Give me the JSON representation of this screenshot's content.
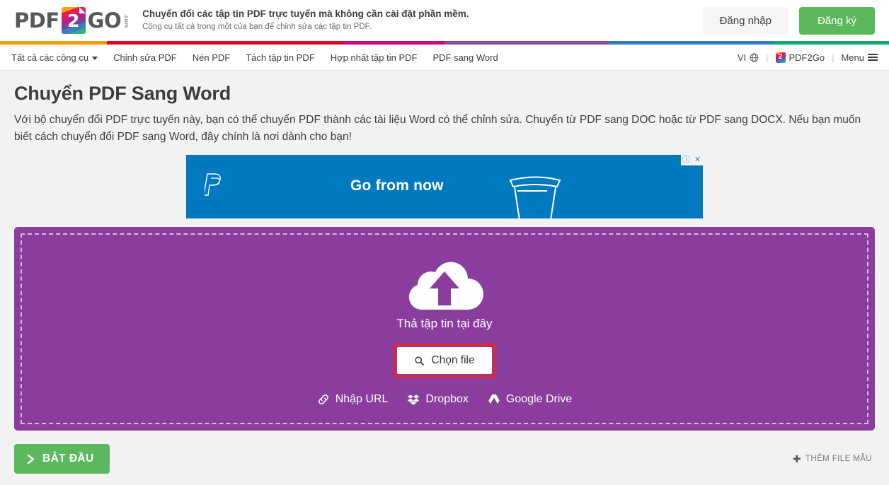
{
  "header": {
    "logo": {
      "part1": "PDF",
      "badge": "2",
      "part2": "GO",
      "suffix": ".com"
    },
    "tagline_main": "Chuyển đổi các tập tin PDF trực tuyến mà không cần cài đặt phần mềm.",
    "tagline_sub": "Công cụ tất cả trong một của bạn để chỉnh sửa các tập tin PDF.",
    "login_label": "Đăng nhập",
    "signup_label": "Đăng ký",
    "signup_color": "#5cb85c"
  },
  "stripe": {
    "colors": [
      "#ef9b0f",
      "#e3051f",
      "#c9077f",
      "#8b4a9e",
      "#2f7fb8",
      "#12a875"
    ],
    "widths": [
      "12%",
      "26.5%",
      "11.5%",
      "18.5%",
      "18.5%",
      "13%"
    ]
  },
  "nav": {
    "items": [
      {
        "label": "Tất cả các công cụ",
        "has_caret": true
      },
      {
        "label": "Chỉnh sửa PDF",
        "has_caret": false
      },
      {
        "label": "Nén PDF",
        "has_caret": false
      },
      {
        "label": "Tách tập tin PDF",
        "has_caret": false
      },
      {
        "label": "Hợp nhất tập tin PDF",
        "has_caret": false
      },
      {
        "label": "PDF sang Word",
        "has_caret": false
      }
    ],
    "language": "VI",
    "language_icon": "globe-icon",
    "account": "PDF2Go",
    "account_badge": "2",
    "menu": "Menu",
    "menu_icon": "hamburger-icon",
    "separator": "|"
  },
  "main": {
    "title": "Chuyển PDF Sang Word",
    "description": "Với bộ chuyển đổi PDF trực tuyến này, bạn có thể chuyển PDF thành các tài liệu Word có thể chỉnh sửa. Chuyển từ PDF sang DOC hoặc từ PDF sang DOCX. Nếu bạn muốn biết cách chuyển đổi PDF sang Word, đây chính là nơi dành cho bạn!"
  },
  "ad": {
    "brand_icon": "paypal-icon",
    "headline": "Go from now",
    "illustration": "cup-icon",
    "background": "#0079c1",
    "info_glyph": "ⓘ",
    "close_glyph": "✕"
  },
  "dropzone": {
    "background": "#8b3d9e",
    "upload_icon": "cloud-upload-icon",
    "drop_label": "Thả tập tin tại đây",
    "choose_file_label": "Chọn file",
    "choose_file_icon": "search-icon",
    "highlight_color": "#e8252a",
    "sources": [
      {
        "label": "Nhập URL",
        "icon": "link-icon"
      },
      {
        "label": "Dropbox",
        "icon": "dropbox-icon"
      },
      {
        "label": "Google Drive",
        "icon": "google-drive-icon"
      }
    ]
  },
  "footer_actions": {
    "start_label": "BẮT ĐẦU",
    "start_icon": "chevron-right-icon",
    "sample_label": "THÊM FILE MẪU",
    "sample_icon": "plus-icon"
  }
}
